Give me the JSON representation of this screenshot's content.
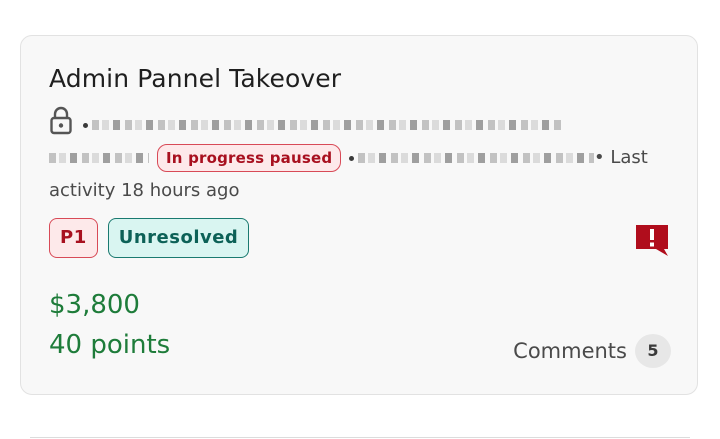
{
  "report": {
    "title": "Admin Pannel Takeover",
    "status": "In progress paused",
    "last_activity": "• Last activity 18 hours ago",
    "priority": "P1",
    "state": "Unresolved",
    "bounty": "$3,800",
    "points": "40 points",
    "comments_label": "Comments",
    "comments_count": "5"
  },
  "icons": {
    "lock": "lock-icon",
    "alert": "alert-comment-icon"
  },
  "colors": {
    "priority_red": "#a8101f",
    "unresolved_teal": "#0c6157",
    "reward_green": "#1e7c3a",
    "alert_red": "#b00d1c"
  }
}
